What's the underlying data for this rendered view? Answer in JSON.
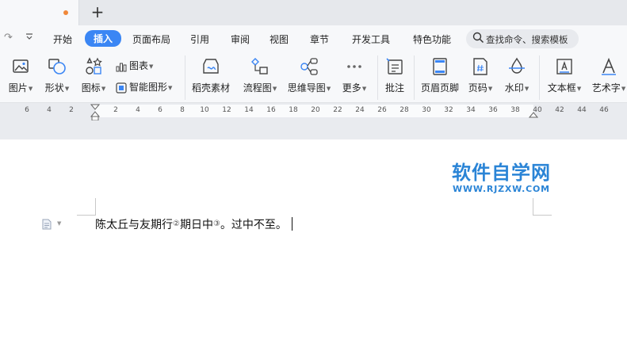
{
  "tabs": {
    "new_tab_label": "+"
  },
  "menu": {
    "items": [
      "开始",
      "插入",
      "页面布局",
      "引用",
      "审阅",
      "视图",
      "章节",
      "开发工具",
      "特色功能"
    ],
    "active": "插入",
    "search_placeholder": "查找命令、搜索模板"
  },
  "ribbon": {
    "picture": "图片",
    "shape": "形状",
    "icon": "图标",
    "chart": "图表",
    "smart_graphic": "智能图形",
    "daoke_material": "稻壳素材",
    "flowchart": "流程图",
    "mindmap": "思维导图",
    "more": "更多",
    "comment": "批注",
    "header_footer": "页眉页脚",
    "page_number": "页码",
    "watermark": "水印",
    "textbox": "文本框",
    "wordart": "艺术字"
  },
  "ruler": {
    "ticks": [
      "6",
      "4",
      "2",
      "2",
      "4",
      "6",
      "8",
      "10",
      "12",
      "14",
      "16",
      "18",
      "20",
      "22",
      "24",
      "26",
      "28",
      "30",
      "32",
      "34",
      "36",
      "38",
      "40",
      "42",
      "44",
      "46"
    ]
  },
  "document": {
    "text_part1": "陈太丘与友期行",
    "note1": "②",
    "text_part2": "期日中",
    "note2": "③",
    "text_part3": "。过中不至。"
  },
  "watermark": {
    "title": "软件自学网",
    "url": "WWW.RJZXW.COM"
  },
  "colors": {
    "accent": "#3b86f4",
    "tab_dot": "#f0883a",
    "watermark": "#2a84d6"
  }
}
